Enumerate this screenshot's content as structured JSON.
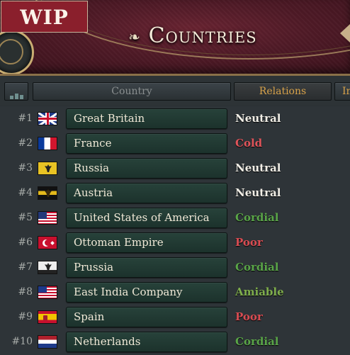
{
  "badge": {
    "label": "WIP"
  },
  "header": {
    "title": "Countries",
    "flourish": "❧"
  },
  "columns": {
    "country": "Country",
    "relations": "Relations",
    "more": "In"
  },
  "rows": [
    {
      "rank": "#1",
      "name": "Great Britain",
      "relation": "Neutral",
      "relation_key": "neutral",
      "flag": "gb-flag-icon"
    },
    {
      "rank": "#2",
      "name": "France",
      "relation": "Cold",
      "relation_key": "cold",
      "flag": "france-flag-icon"
    },
    {
      "rank": "#3",
      "name": "Russia",
      "relation": "Neutral",
      "relation_key": "neutral",
      "flag": "russia-flag-icon"
    },
    {
      "rank": "#4",
      "name": "Austria",
      "relation": "Neutral",
      "relation_key": "neutral",
      "flag": "austria-flag-icon"
    },
    {
      "rank": "#5",
      "name": "United States of America",
      "relation": "Cordial",
      "relation_key": "cordial",
      "flag": "usa-flag-icon"
    },
    {
      "rank": "#6",
      "name": "Ottoman Empire",
      "relation": "Poor",
      "relation_key": "poor",
      "flag": "ottoman-flag-icon"
    },
    {
      "rank": "#7",
      "name": "Prussia",
      "relation": "Cordial",
      "relation_key": "cordial",
      "flag": "prussia-flag-icon"
    },
    {
      "rank": "#8",
      "name": "East India Company",
      "relation": "Amiable",
      "relation_key": "amiable",
      "flag": "eic-flag-icon"
    },
    {
      "rank": "#9",
      "name": "Spain",
      "relation": "Poor",
      "relation_key": "poor",
      "flag": "spain-flag-icon"
    },
    {
      "rank": "#10",
      "name": "Netherlands",
      "relation": "Cordial",
      "relation_key": "cordial",
      "flag": "netherlands-flag-icon"
    }
  ],
  "colors": {
    "neutral": "#f1eee6",
    "cold": "#e0545a",
    "poor": "#d84c52",
    "cordial": "#5aa548",
    "amiable": "#7fae4c",
    "header_bg": "#4e1a26",
    "accent_gold": "#d8a24a"
  }
}
